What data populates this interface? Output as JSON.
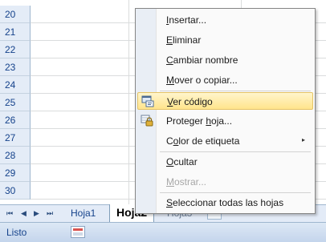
{
  "rows": [
    "20",
    "21",
    "22",
    "23",
    "24",
    "25",
    "26",
    "27",
    "28",
    "29",
    "30"
  ],
  "sheet_nav": {
    "first": "⏮",
    "prev": "◀",
    "next": "▶",
    "last": "⏭"
  },
  "sheet_tabs": [
    {
      "label": "Hoja1",
      "active": false
    },
    {
      "label": "Hoja2",
      "active": true
    },
    {
      "label": "Hoja3",
      "active": false
    }
  ],
  "status": {
    "text": "Listo"
  },
  "context_menu": {
    "items": [
      {
        "pre": "",
        "u": "I",
        "post": "nsertar...",
        "icon": "",
        "disabled": false,
        "highlight": false,
        "submenu": false
      },
      {
        "pre": "",
        "u": "E",
        "post": "liminar",
        "icon": "",
        "disabled": false,
        "highlight": false,
        "submenu": false
      },
      {
        "pre": "",
        "u": "C",
        "post": "ambiar nombre",
        "icon": "",
        "disabled": false,
        "highlight": false,
        "submenu": false
      },
      {
        "pre": "",
        "u": "M",
        "post": "over o copiar...",
        "icon": "",
        "disabled": false,
        "highlight": false,
        "submenu": false
      },
      {
        "pre": "",
        "u": "V",
        "post": "er código",
        "icon": "view-code-icon",
        "disabled": false,
        "highlight": true,
        "submenu": false
      },
      {
        "pre": "Proteger ",
        "u": "h",
        "post": "oja...",
        "icon": "protect-sheet-icon",
        "disabled": false,
        "highlight": false,
        "submenu": false
      },
      {
        "pre": "C",
        "u": "o",
        "post": "lor de etiqueta",
        "icon": "",
        "disabled": false,
        "highlight": false,
        "submenu": true
      },
      {
        "pre": "",
        "u": "O",
        "post": "cultar",
        "icon": "",
        "disabled": false,
        "highlight": false,
        "submenu": false
      },
      {
        "pre": "",
        "u": "M",
        "post": "ostrar...",
        "icon": "",
        "disabled": true,
        "highlight": false,
        "submenu": false
      },
      {
        "pre": "",
        "u": "S",
        "post": "eleccionar todas las hojas",
        "icon": "",
        "disabled": false,
        "highlight": false,
        "submenu": false
      }
    ],
    "submenu_arrow": "▸"
  },
  "colors": {
    "highlight": "#ffe48c",
    "row_header": "#e4ecf7",
    "status_bar": "#c4d5ec"
  }
}
